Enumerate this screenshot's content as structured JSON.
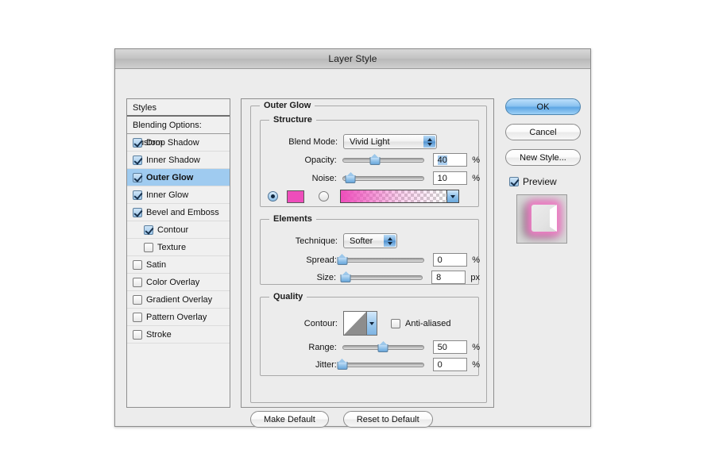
{
  "dialog": {
    "title": "Layer Style"
  },
  "styles_panel": {
    "header": "Styles",
    "blending_options": "Blending Options: Custom",
    "items": [
      {
        "label": "Drop Shadow",
        "checked": true,
        "selected": false,
        "indent": false
      },
      {
        "label": "Inner Shadow",
        "checked": true,
        "selected": false,
        "indent": false
      },
      {
        "label": "Outer Glow",
        "checked": true,
        "selected": true,
        "indent": false
      },
      {
        "label": "Inner Glow",
        "checked": true,
        "selected": false,
        "indent": false
      },
      {
        "label": "Bevel and Emboss",
        "checked": true,
        "selected": false,
        "indent": false
      },
      {
        "label": "Contour",
        "checked": true,
        "selected": false,
        "indent": true
      },
      {
        "label": "Texture",
        "checked": false,
        "selected": false,
        "indent": true
      },
      {
        "label": "Satin",
        "checked": false,
        "selected": false,
        "indent": false
      },
      {
        "label": "Color Overlay",
        "checked": false,
        "selected": false,
        "indent": false
      },
      {
        "label": "Gradient Overlay",
        "checked": false,
        "selected": false,
        "indent": false
      },
      {
        "label": "Pattern Overlay",
        "checked": false,
        "selected": false,
        "indent": false
      },
      {
        "label": "Stroke",
        "checked": false,
        "selected": false,
        "indent": false
      }
    ]
  },
  "panel": {
    "legend": "Outer Glow",
    "structure": {
      "legend": "Structure",
      "blend_mode_label": "Blend Mode:",
      "blend_mode_value": "Vivid Light",
      "opacity_label": "Opacity:",
      "opacity_value": "40",
      "opacity_unit": "%",
      "opacity_percent": 40,
      "noise_label": "Noise:",
      "noise_value": "10",
      "noise_unit": "%",
      "noise_percent": 10,
      "fill_type": "color",
      "color_swatch": "#ee4dbb",
      "gradient_from": "#ee4dbb",
      "gradient_to": "#ffffff"
    },
    "elements": {
      "legend": "Elements",
      "technique_label": "Technique:",
      "technique_value": "Softer",
      "spread_label": "Spread:",
      "spread_value": "0",
      "spread_unit": "%",
      "spread_percent": 0,
      "size_label": "Size:",
      "size_value": "8",
      "size_unit": "px",
      "size_percent": 5
    },
    "quality": {
      "legend": "Quality",
      "contour_label": "Contour:",
      "antialiased_label": "Anti-aliased",
      "antialiased_checked": false,
      "range_label": "Range:",
      "range_value": "50",
      "range_unit": "%",
      "range_percent": 50,
      "jitter_label": "Jitter:",
      "jitter_value": "0",
      "jitter_unit": "%",
      "jitter_percent": 0
    }
  },
  "buttons": {
    "ok": "OK",
    "cancel": "Cancel",
    "new_style": "New Style...",
    "make_default": "Make Default",
    "reset_to_default": "Reset to Default"
  },
  "preview": {
    "label": "Preview",
    "checked": true,
    "glow_color": "#ef7fc6"
  }
}
